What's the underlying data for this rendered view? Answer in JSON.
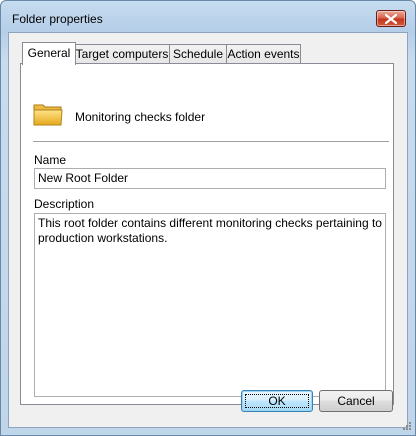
{
  "window": {
    "title": "Folder properties"
  },
  "tabs": [
    {
      "label": "General",
      "active": true
    },
    {
      "label": "Target computers",
      "active": false
    },
    {
      "label": "Schedule",
      "active": false
    },
    {
      "label": "Action events",
      "active": false
    }
  ],
  "general": {
    "header_label": "Monitoring checks folder",
    "folder_icon": "folder-icon",
    "name_label": "Name",
    "name_value": "New Root Folder",
    "description_label": "Description",
    "description_value": "This root folder contains different monitoring checks pertaining to\nproduction workstations."
  },
  "buttons": {
    "ok": "OK",
    "cancel": "Cancel"
  },
  "colors": {
    "title_bar": "#bfd5ea",
    "close_button": "#c2361c",
    "dialog_bg": "#f0f0f0",
    "default_button": "#bee6fd"
  }
}
